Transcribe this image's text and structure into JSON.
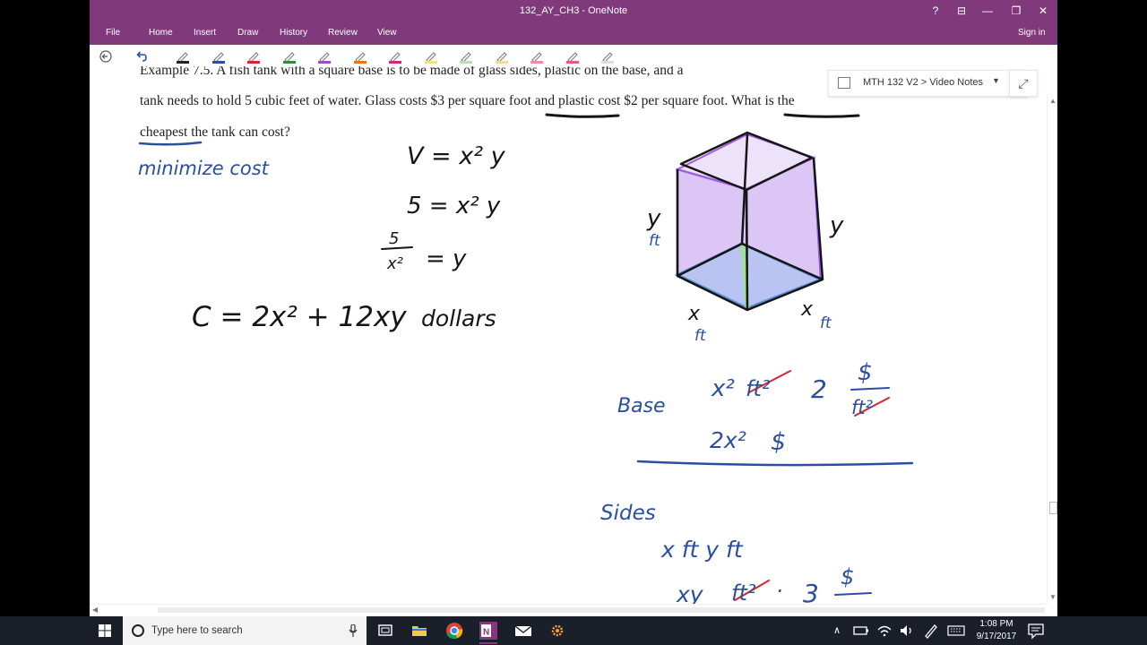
{
  "window": {
    "title": "132_AY_CH3 - OneNote",
    "controls": [
      "?",
      "⊟",
      "—",
      "❐",
      "✕"
    ]
  },
  "ribbon": {
    "tabs": [
      "File",
      "Home",
      "Insert",
      "Draw",
      "History",
      "Review",
      "View"
    ],
    "sign_in": "Sign in"
  },
  "toolbar": {
    "pens": [
      {
        "color": "#222222"
      },
      {
        "color": "#2b4f9e"
      },
      {
        "color": "#d9232f"
      },
      {
        "color": "#2f8a3a"
      },
      {
        "color": "#9d4fbf"
      },
      {
        "color": "#e07b1a"
      },
      {
        "color": "#cc2a7a"
      },
      {
        "color": "#f4e08a"
      },
      {
        "color": "#b9dfb0"
      },
      {
        "color": "#f6d99b"
      },
      {
        "color": "#f08aa8"
      },
      {
        "color": "#e05a8a"
      },
      {
        "color": "#dddddd"
      }
    ]
  },
  "page": {
    "problem": {
      "line1": "Example 7.5. A fish tank with a square base is to be made of glass sides, plastic on the base, and a",
      "line2": "tank needs to hold 5 cubic feet of water. Glass costs $3 per square foot and plastic cost $2 per square foot. What is the",
      "line3": "cheapest the tank can cost?"
    },
    "breadcrumb": "MTH 132 V2 > Video Notes",
    "ink": {
      "minimize_cost": "minimize cost",
      "volume_eq": "V = x² y",
      "five_eq": "5 = x² y",
      "frac_num": "5",
      "frac_den": "x²",
      "frac_eq": "= y",
      "cost_eq": "C = 2x² + 12xy",
      "dollars": "dollars",
      "y_left": "y",
      "ft_left": "ft",
      "y_right": "y",
      "x_left": "x",
      "ft_x_left": "ft",
      "x_right": "x",
      "ft_x_right": "ft",
      "base": "Base",
      "base_area": "x²",
      "base_unit": "ft²",
      "base_price": "2",
      "dollar_sign": "$",
      "price_unit": "ft²",
      "base_cost": "2x²",
      "base_cost_sign": "$",
      "sides": "Sides",
      "sides_dims": "x ft  y ft",
      "sides_area": "xy",
      "sides_unit": "ft²",
      "sides_dot": "·",
      "sides_price": "3",
      "sides_dollar": "$"
    }
  },
  "taskbar": {
    "search_placeholder": "Type here to search",
    "time": "1:08 PM",
    "date": "9/17/2017"
  },
  "colors": {
    "onenote_purple": "#80397b",
    "ink_blue": "#2b4f9e",
    "ink_black": "#151515",
    "cancel_red": "#d9232f",
    "tank_purple": "#b48ce6",
    "tank_blue": "#5b8fd6",
    "tank_green": "#9fe09f"
  }
}
